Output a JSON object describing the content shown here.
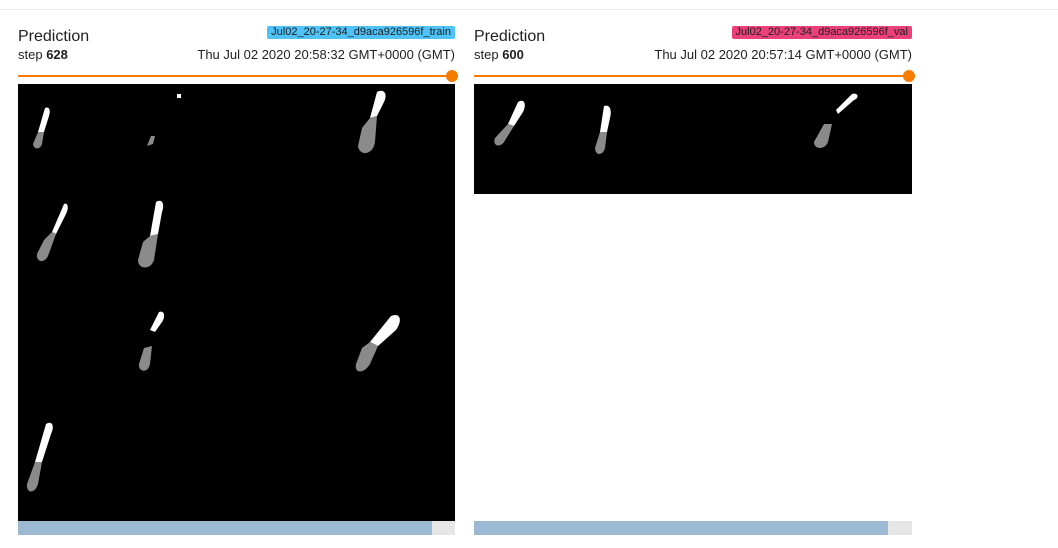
{
  "colors": {
    "train_tag": "#4fc3f7",
    "val_tag": "#ec407a",
    "slider": "#f57c00",
    "scrollbar_thumb": "#9bb9d3"
  },
  "cards": [
    {
      "title": "Prediction",
      "step_label": "step",
      "step_value": "628",
      "run_tag": "Jul02_20-27-34_d9aca926596f_train",
      "timestamp": "Thu Jul 02 2020 20:58:32 GMT+0000 (GMT)",
      "slider_position": 1.0,
      "scroll_fraction": 0.95
    },
    {
      "title": "Prediction",
      "step_label": "step",
      "step_value": "600",
      "run_tag": "Jul02_20-27-34_d9aca926596f_val",
      "timestamp": "Thu Jul 02 2020 20:57:14 GMT+0000 (GMT)",
      "slider_position": 1.0,
      "scroll_fraction": 0.95
    }
  ]
}
